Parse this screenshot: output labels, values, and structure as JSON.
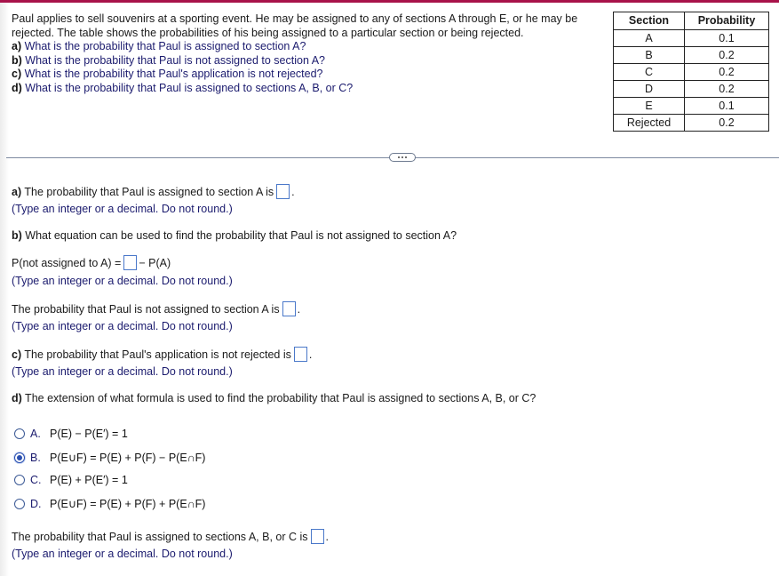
{
  "problem": {
    "intro": "Paul applies to sell souvenirs at a sporting event. He may be assigned to any of sections A through E, or he may be rejected. The table shows the probabilities of his being assigned to a particular section or being rejected.",
    "questions": [
      {
        "label": "a)",
        "text": " What is the probability that Paul is assigned to section A?"
      },
      {
        "label": "b)",
        "text": " What is the probability that Paul is not assigned to section A?"
      },
      {
        "label": "c)",
        "text": " What is the probability that Paul's application is not rejected?"
      },
      {
        "label": "d)",
        "text": " What is the probability that Paul is assigned to sections A, B, or C?"
      }
    ]
  },
  "table": {
    "headers": [
      "Section",
      "Probability"
    ],
    "rows": [
      [
        "A",
        "0.1"
      ],
      [
        "B",
        "0.2"
      ],
      [
        "C",
        "0.2"
      ],
      [
        "D",
        "0.2"
      ],
      [
        "E",
        "0.1"
      ],
      [
        "Rejected",
        "0.2"
      ]
    ]
  },
  "divider": {
    "more_icon": "ellipsis-icon"
  },
  "answers": {
    "a": {
      "label": "a)",
      "text": " The probability that Paul is assigned to section A is",
      "value": "",
      "after": ".",
      "hint": "(Type an integer or a decimal. Do not round.)"
    },
    "b_question": {
      "label": "b)",
      "text": " What equation can be used to find the probability that Paul is not assigned to section A?"
    },
    "b_equation": {
      "left": "P(not assigned to A) =",
      "value": "",
      "right": "− P(A)",
      "hint": "(Type an integer or a decimal. Do not round.)"
    },
    "b_result": {
      "text": "The probability that Paul is not assigned to section A is",
      "value": "",
      "after": ".",
      "hint": "(Type an integer or a decimal. Do not round.)"
    },
    "c": {
      "label": "c)",
      "text": " The probability that Paul's application is not rejected is",
      "value": "",
      "after": ".",
      "hint": "(Type an integer or a decimal. Do not round.)"
    },
    "d_question": {
      "label": "d)",
      "text": " The extension of what formula is used to find the probability that Paul is assigned to sections A, B, or C?"
    },
    "d_options": [
      {
        "letter": "A.",
        "formula": "P(E) − P(E′) = 1",
        "selected": false
      },
      {
        "letter": "B.",
        "formula": "P(E∪F) = P(E) + P(F) − P(E∩F)",
        "selected": true
      },
      {
        "letter": "C.",
        "formula": "P(E) + P(E′) = 1",
        "selected": false
      },
      {
        "letter": "D.",
        "formula": "P(E∪F) = P(E) + P(F) + P(E∩F)",
        "selected": false
      }
    ],
    "d_result": {
      "text": "The probability that Paul is assigned to sections A, B, or C is",
      "value": "",
      "after": ".",
      "hint": "(Type an integer or a decimal. Do not round.)"
    }
  }
}
